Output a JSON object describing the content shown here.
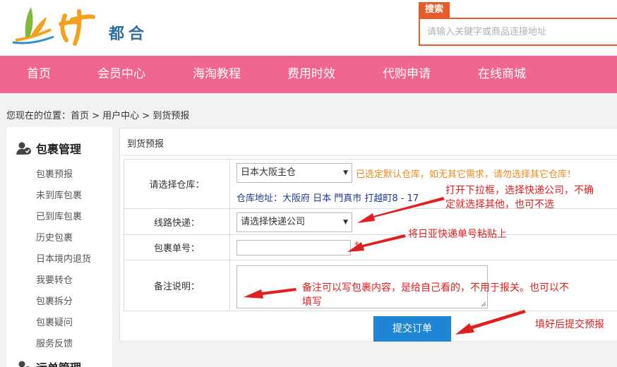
{
  "logo": {
    "text": "都合"
  },
  "search": {
    "label": "搜索",
    "placeholder": "请输入关键字或商品连接地址"
  },
  "nav": [
    "首页",
    "会员中心",
    "海淘教程",
    "费用时效",
    "代购申请",
    "在线商城"
  ],
  "breadcrumb": "您现在的位置：首页 > 用户中心 > 到货预报",
  "sidebar": {
    "section1": "包裹管理",
    "items": [
      "包裹预报",
      "未到库包裹",
      "已到库包裹",
      "历史包裹",
      "日本境内退货",
      "我要转仓",
      "包裹拆分",
      "包裹疑问",
      "服务反馈"
    ],
    "section2": "运单管理"
  },
  "panel": {
    "title": "到货预报"
  },
  "form": {
    "warehouse_label": "请选择仓库：",
    "warehouse_value": "日本大阪主仓",
    "warehouse_warning": "已选定默认仓库，如无其它需求，请勿选择其它仓库！",
    "warehouse_address": "仓库地址：大阪府 日本 門真市 打越町8 - 17",
    "express_label": "线路快递：",
    "express_value": "请选择快递公司",
    "tracking_label": "包裹单号：",
    "tracking_required": "*",
    "remark_label": "备注说明：",
    "submit_label": "提交订单"
  },
  "annotations": {
    "express_note_1": "打开下拉框，选择快递公司，不确",
    "express_note_2": "定就选择其他，也可不选",
    "tracking_note": "将日亚快递单号粘贴上",
    "remark_note_1": "备注可以写包裹内容，是给自己看的，不用于报关。也可以不",
    "remark_note_2": "填写",
    "submit_note": "填好后提交预报"
  },
  "colors": {
    "nav_bg": "#f0668f",
    "accent": "#ea5b2a",
    "button": "#1f86d6",
    "annotation": "#e02020",
    "warning": "#ea8a1f"
  }
}
